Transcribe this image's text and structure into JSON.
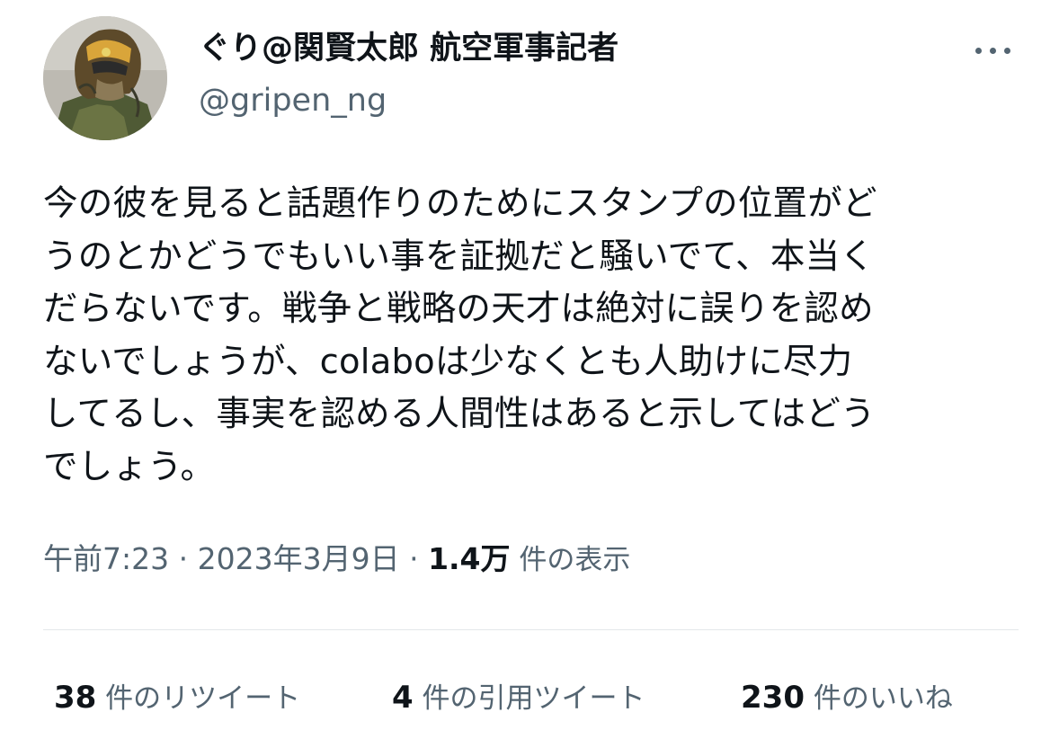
{
  "user": {
    "display_name": "ぐり@関賢太郎 航空軍事記者",
    "handle": "@gripen_ng",
    "avatar_icon": "pilot-helmet-avatar"
  },
  "more_icon": "more-dots-icon",
  "tweet": {
    "text_lines": [
      "今の彼を見ると話題作りのためにスタンプの位置がど",
      "うのとかどうでもいい事を証拠だと騒いでて、本当く",
      "だらないです。戦争と戦略の天才は絶対に誤りを認め",
      "ないでしょうが、colaboは少なくとも人助けに尽力",
      "してるし、事実を認める人間性はあると示してはどう",
      "でしょう。"
    ]
  },
  "meta": {
    "time": "午前7:23",
    "separator1": " · ",
    "date": "2023年3月9日",
    "separator2": " · ",
    "views_count": "1.4万",
    "views_label": " 件の表示"
  },
  "stats": {
    "retweets_count": "38",
    "retweets_label": " 件のリツイート",
    "quotes_count": "4",
    "quotes_label": " 件の引用ツイート",
    "likes_count": "230",
    "likes_label": " 件のいいね"
  },
  "colors": {
    "text_primary": "#0f1419",
    "text_secondary": "#536471",
    "divider": "#e3e7ea"
  }
}
